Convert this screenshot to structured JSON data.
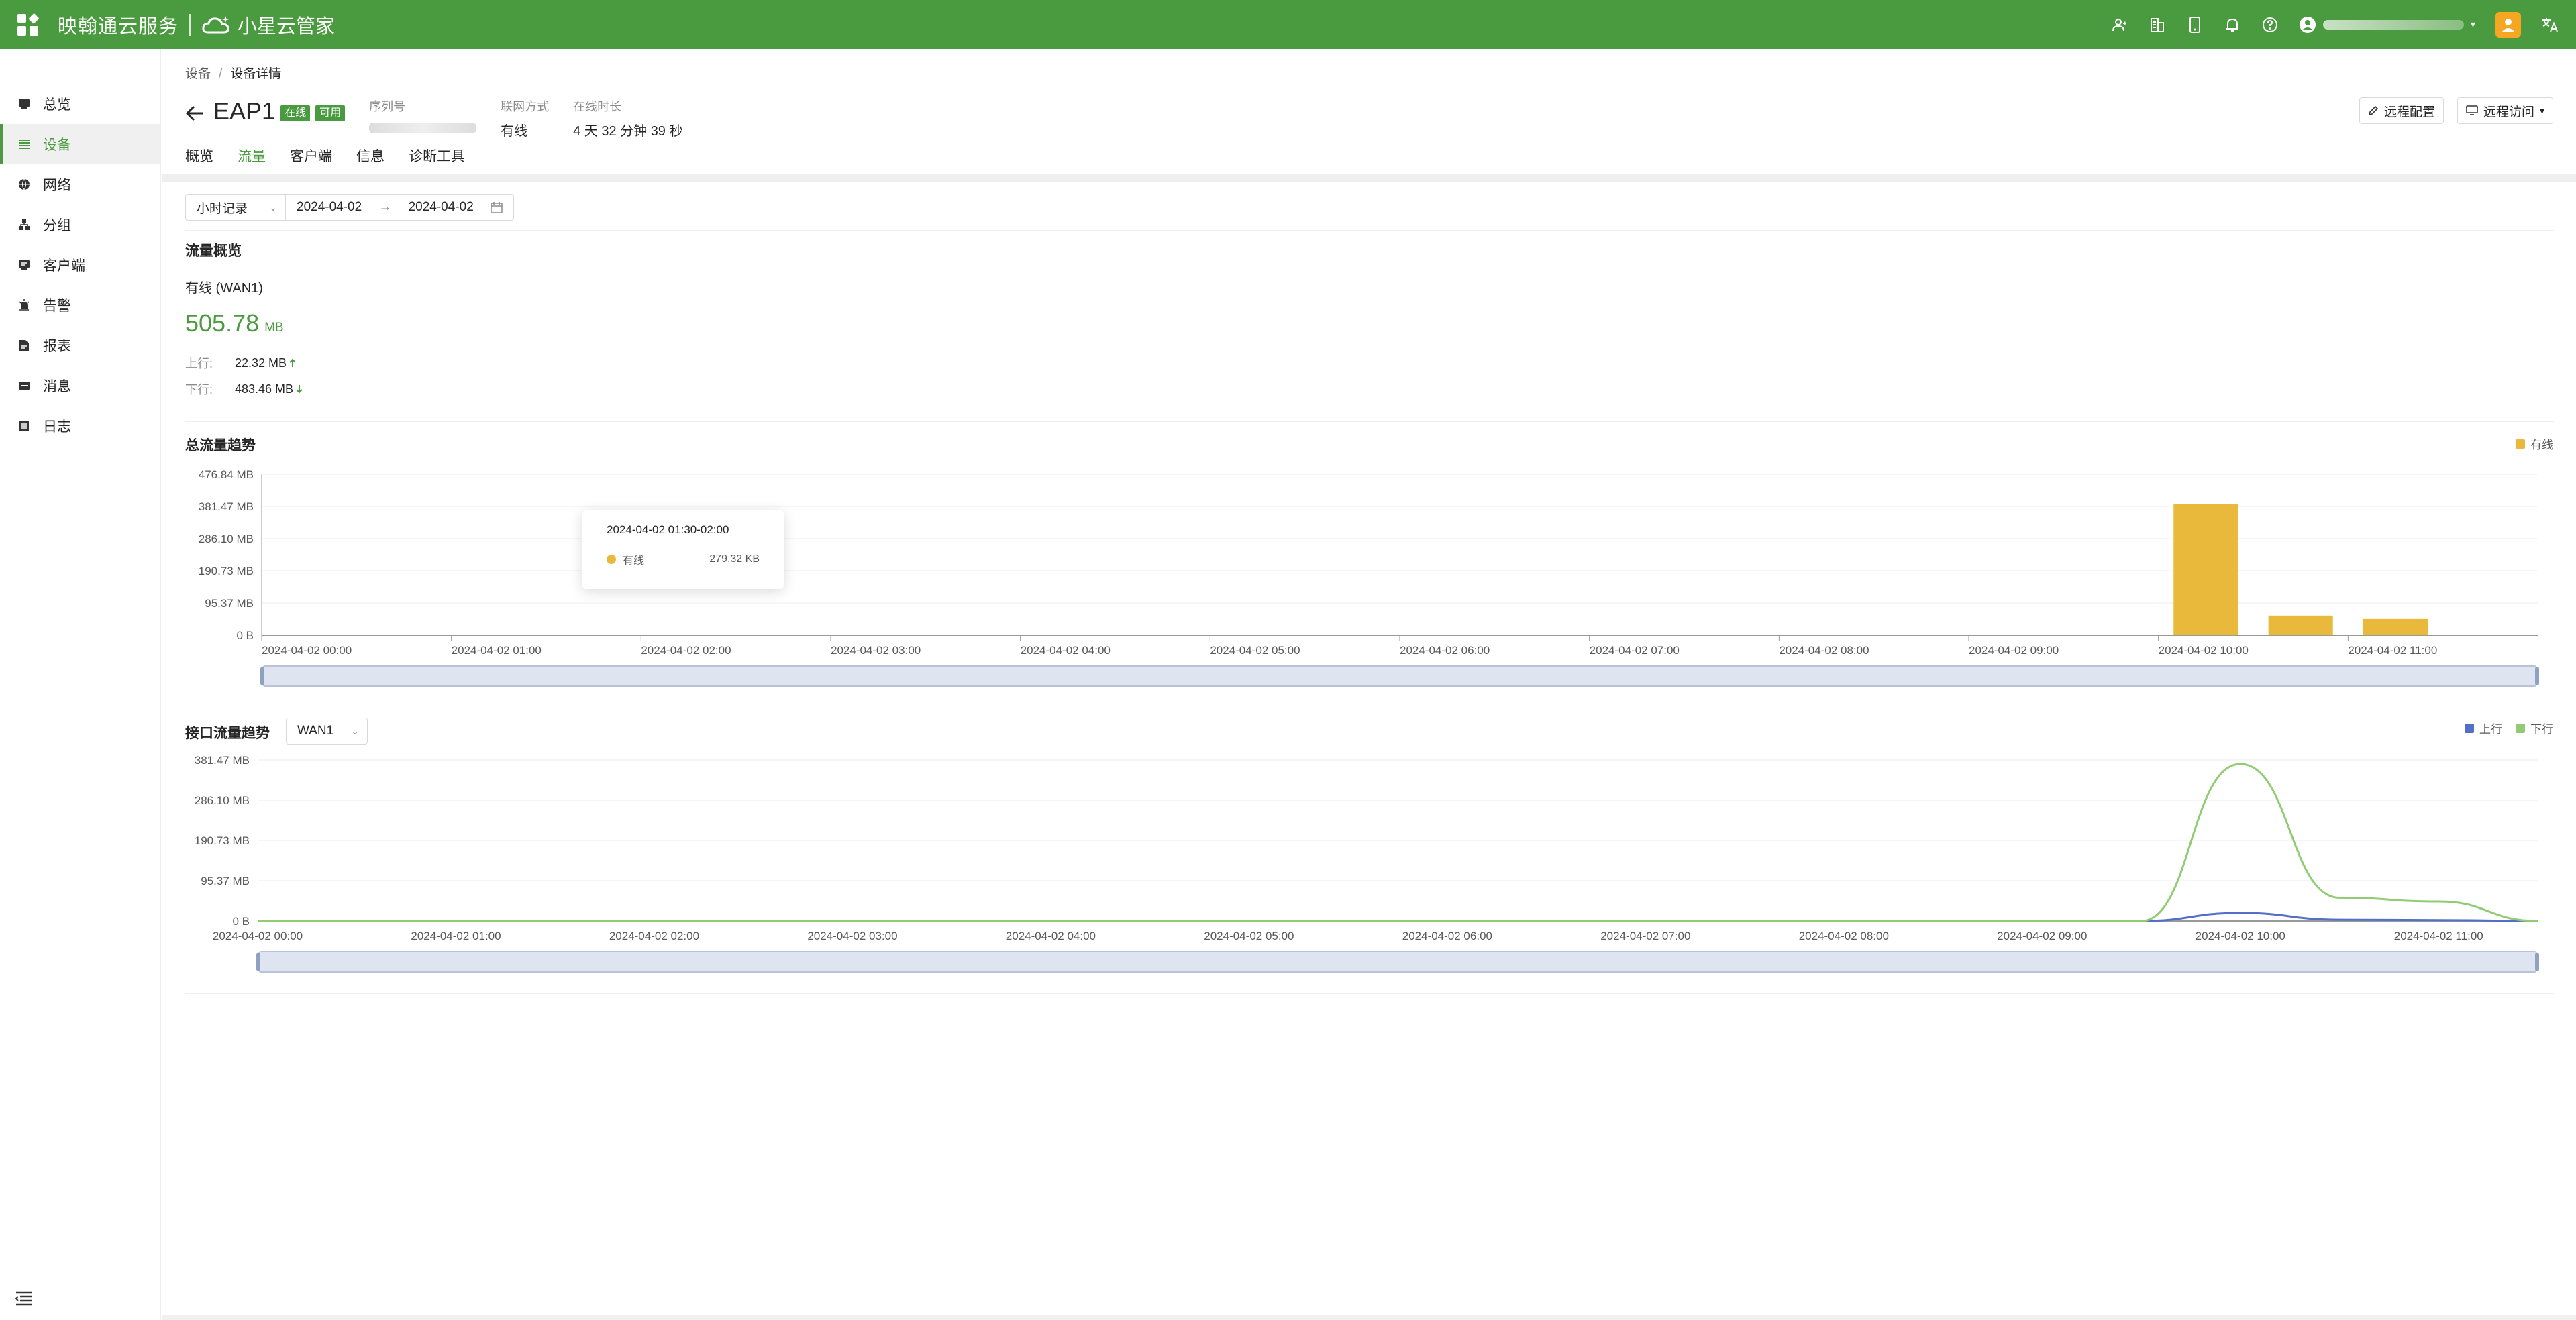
{
  "topbar": {
    "brand": "映翰通云服务",
    "brand2": "小星云管家"
  },
  "sidebar": {
    "items": [
      {
        "label": "总览",
        "icon": "dashboard-icon"
      },
      {
        "label": "设备",
        "icon": "device-list-icon",
        "active": true
      },
      {
        "label": "网络",
        "icon": "globe-icon"
      },
      {
        "label": "分组",
        "icon": "group-icon"
      },
      {
        "label": "客户端",
        "icon": "client-icon"
      },
      {
        "label": "告警",
        "icon": "alarm-icon"
      },
      {
        "label": "报表",
        "icon": "report-icon"
      },
      {
        "label": "消息",
        "icon": "message-icon"
      },
      {
        "label": "日志",
        "icon": "log-icon"
      }
    ]
  },
  "breadcrumb": {
    "root": "设备",
    "separator": "/",
    "current": "设备详情"
  },
  "device": {
    "name": "EAP1",
    "badges": [
      "在线",
      "可用"
    ],
    "serial_label": "序列号",
    "conn_label": "联网方式",
    "conn_value": "有线",
    "uptime_label": "在线时长",
    "uptime_value": "4 天 32 分钟 39 秒"
  },
  "actions": {
    "remote_config": "远程配置",
    "remote_access": "远程访问"
  },
  "tabs": [
    "概览",
    "流量",
    "客户端",
    "信息",
    "诊断工具"
  ],
  "active_tab": "流量",
  "filter": {
    "granularity": "小时记录",
    "start_date": "2024-04-02",
    "range_arrow": "→",
    "end_date": "2024-04-02"
  },
  "overview": {
    "title": "流量概览",
    "interface": "有线 (WAN1)",
    "total_value": "505.78",
    "total_unit": "MB",
    "up_label": "上行:",
    "up_value": "22.32 MB",
    "down_label": "下行:",
    "down_value": "483.46 MB"
  },
  "colors": {
    "brand": "#4a9a3f",
    "bar": "#e8b93a",
    "up": "#5470c6",
    "down": "#91cc75"
  },
  "chart_data": [
    {
      "type": "bar",
      "title": "总流量趋势",
      "legend": [
        "有线"
      ],
      "legend_position": "top-right",
      "yticks": [
        "0 B",
        "95.37 MB",
        "190.73 MB",
        "286.10 MB",
        "381.47 MB",
        "476.84 MB"
      ],
      "ylim_mb": [
        0,
        476.84
      ],
      "xticks": [
        "2024-04-02 00:00",
        "2024-04-02 01:00",
        "2024-04-02 02:00",
        "2024-04-02 03:00",
        "2024-04-02 04:00",
        "2024-04-02 05:00",
        "2024-04-02 06:00",
        "2024-04-02 07:00",
        "2024-04-02 08:00",
        "2024-04-02 09:00",
        "2024-04-02 10:00",
        "2024-04-02 11:00"
      ],
      "categories": [
        "00:00",
        "00:30",
        "01:00",
        "01:30",
        "02:00",
        "02:30",
        "03:00",
        "03:30",
        "04:00",
        "04:30",
        "05:00",
        "05:30",
        "06:00",
        "06:30",
        "07:00",
        "07:30",
        "08:00",
        "08:30",
        "09:00",
        "09:30",
        "10:00",
        "10:30",
        "11:00",
        "11:30"
      ],
      "series": [
        {
          "name": "有线",
          "values_mb": [
            0,
            0,
            0,
            0.27,
            0,
            0,
            0,
            0,
            0,
            0,
            0,
            0,
            0,
            0,
            0,
            0,
            0,
            0,
            0,
            0,
            388,
            58,
            48,
            0
          ]
        }
      ],
      "tooltip": {
        "title": "2024-04-02 01:30-02:00",
        "series": "有线",
        "value": "279.32 KB"
      }
    },
    {
      "type": "line",
      "title": "接口流量趋势",
      "interface_select": "WAN1",
      "legend": [
        "上行",
        "下行"
      ],
      "legend_position": "top-right",
      "yticks": [
        "0 B",
        "95.37 MB",
        "190.73 MB",
        "286.10 MB",
        "381.47 MB"
      ],
      "ylim_mb": [
        0,
        381.47
      ],
      "xticks": [
        "2024-04-02 00:00",
        "2024-04-02 01:00",
        "2024-04-02 02:00",
        "2024-04-02 03:00",
        "2024-04-02 04:00",
        "2024-04-02 05:00",
        "2024-04-02 06:00",
        "2024-04-02 07:00",
        "2024-04-02 08:00",
        "2024-04-02 09:00",
        "2024-04-02 10:00",
        "2024-04-02 11:00"
      ],
      "x_hours": [
        0,
        0.5,
        1,
        1.5,
        2,
        2.5,
        3,
        3.5,
        4,
        4.5,
        5,
        5.5,
        6,
        6.5,
        7,
        7.5,
        8,
        8.5,
        9,
        9.5,
        10,
        10.5,
        11,
        11.5
      ],
      "series": [
        {
          "name": "上行",
          "values_mb": [
            0,
            0,
            0,
            0,
            0,
            0,
            0,
            0,
            0,
            0,
            0,
            0,
            0,
            0,
            0,
            0,
            0,
            0,
            0,
            0,
            19,
            3,
            2,
            0
          ]
        },
        {
          "name": "下行",
          "values_mb": [
            0,
            0,
            0,
            0,
            0,
            0,
            0,
            0,
            0,
            0,
            0,
            0,
            0,
            0,
            0,
            0,
            0,
            0,
            0,
            0,
            372,
            55,
            46,
            0
          ]
        }
      ]
    }
  ]
}
